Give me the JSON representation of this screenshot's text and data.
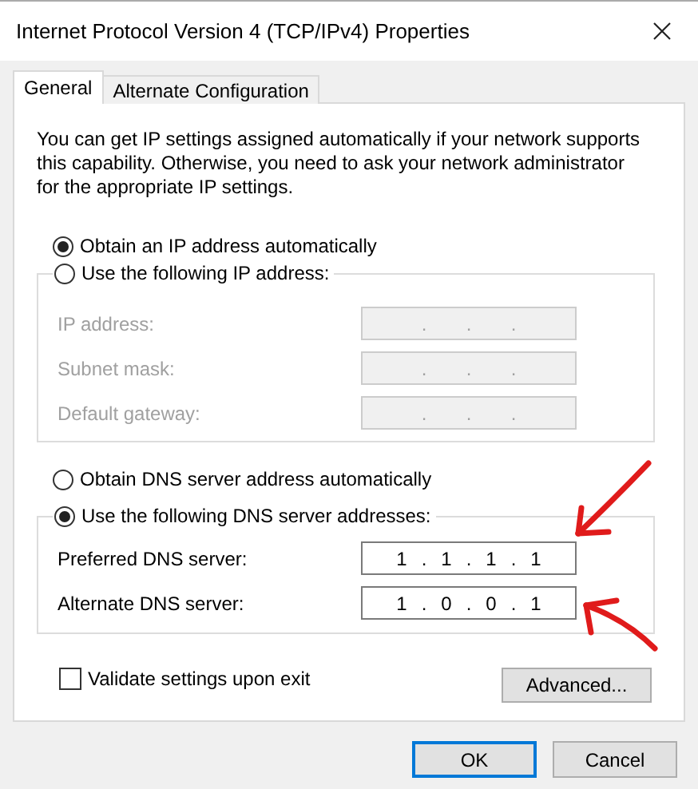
{
  "window": {
    "title": "Internet Protocol Version 4 (TCP/IPv4) Properties"
  },
  "tabs": [
    {
      "label": "General",
      "selected": true
    },
    {
      "label": "Alternate Configuration",
      "selected": false
    }
  ],
  "intro": "You can get IP settings assigned automatically if your network supports\nthis capability. Otherwise, you need to ask your network administrator\nfor the appropriate IP settings.",
  "ip_separator": ".",
  "ip_mode": [
    {
      "label": "Obtain an IP address automatically",
      "selected": true
    },
    {
      "label": "Use the following IP address:",
      "selected": false
    }
  ],
  "ip_fields": [
    {
      "label": "IP address:",
      "disabled": true
    },
    {
      "label": "Subnet mask:",
      "disabled": true
    },
    {
      "label": "Default gateway:",
      "disabled": true
    }
  ],
  "dns_mode": [
    {
      "label": "Obtain DNS server address automatically",
      "selected": false
    },
    {
      "label": "Use the following DNS server addresses:",
      "selected": true
    }
  ],
  "dns_fields": [
    {
      "label": "Preferred DNS server:",
      "disabled": false,
      "octets": [
        "1",
        "1",
        "1",
        "1"
      ]
    },
    {
      "label": "Alternate DNS server:",
      "disabled": false,
      "octets": [
        "1",
        "0",
        "0",
        "1"
      ]
    }
  ],
  "validate": {
    "label": "Validate settings upon exit",
    "checked": false
  },
  "advanced_button": "Advanced...",
  "buttons": [
    {
      "label": "OK",
      "default": true
    },
    {
      "label": "Cancel",
      "default": false
    }
  ]
}
